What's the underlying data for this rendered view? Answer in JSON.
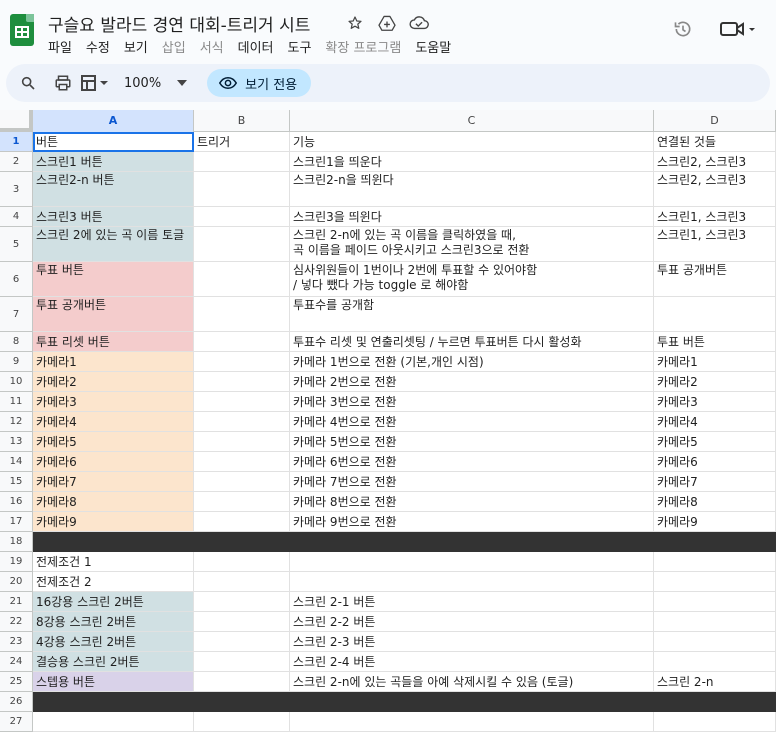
{
  "app": {
    "title": "구슬요 발라드 경연 대회-트리거 시트",
    "menus": [
      {
        "label": "파일",
        "dim": false
      },
      {
        "label": "수정",
        "dim": false
      },
      {
        "label": "보기",
        "dim": false
      },
      {
        "label": "삽입",
        "dim": true
      },
      {
        "label": "서식",
        "dim": true
      },
      {
        "label": "데이터",
        "dim": false
      },
      {
        "label": "도구",
        "dim": false
      },
      {
        "label": "확장 프로그램",
        "dim": true
      },
      {
        "label": "도움말",
        "dim": false
      }
    ],
    "icons": [
      "star-icon",
      "drive-add-icon",
      "cloud-status-icon",
      "history-icon",
      "video-call-icon"
    ]
  },
  "toolbar": {
    "zoom": "100%",
    "view_only_label": "보기 전용"
  },
  "colors": {
    "teal": "#d0e0e3",
    "pink": "#f4cccc",
    "orange": "#fce5cd",
    "purple": "#d9d2e9",
    "dark": "#333333"
  },
  "columns": [
    "A",
    "B",
    "C",
    "D"
  ],
  "rows": [
    {
      "n": "1",
      "h": 20,
      "fill": "",
      "cells": [
        "버튼",
        "트리거",
        "기능",
        "연결된 것들"
      ]
    },
    {
      "n": "2",
      "h": 20,
      "fill": "teal",
      "cells": [
        "스크린1 버튼",
        "",
        "스크린1을 띄운다",
        "스크린2, 스크린3"
      ]
    },
    {
      "n": "3",
      "h": 35,
      "fill": "teal",
      "cells": [
        "스크린2-n 버튼",
        "",
        "스크린2-n을 띄윈다",
        "스크린2, 스크린3"
      ]
    },
    {
      "n": "4",
      "h": 20,
      "fill": "teal",
      "cells": [
        "스크린3 버튼",
        "",
        "스크린3을 띄윈다",
        "스크린1, 스크린3"
      ]
    },
    {
      "n": "5",
      "h": 35,
      "fill": "teal",
      "cells": [
        "스크린 2에 있는 곡 이름 토글",
        "",
        "스크린 2-n에 있는 곡 이름을 클릭하였을 때,\n곡 이름을 페이드 아웃시키고 스크린3으로 전환",
        "스크린1, 스크린3"
      ]
    },
    {
      "n": "6",
      "h": 35,
      "fill": "pink",
      "cells": [
        "투표 버튼",
        "",
        "심사위원들이 1번이나 2번에 투표할 수 있어야함\n/ 넣다 뺐다 가능 toggle 로 해야함",
        "투표 공개버튼"
      ]
    },
    {
      "n": "7",
      "h": 35,
      "fill": "pink",
      "cells": [
        "투표 공개버튼",
        "",
        "투표수를 공개함",
        ""
      ]
    },
    {
      "n": "8",
      "h": 20,
      "fill": "pink",
      "cells": [
        "투표 리셋 버튼",
        "",
        "투표수 리셋 및 연출리셋팅 / 누르면 투표버튼 다시 활성화",
        "투표 버튼"
      ]
    },
    {
      "n": "9",
      "h": 20,
      "fill": "orange",
      "cells": [
        "카메라1",
        "",
        "카메라 1번으로 전환 (기본,개인 시점)",
        "카메라1"
      ]
    },
    {
      "n": "10",
      "h": 20,
      "fill": "orange",
      "cells": [
        "카메라2",
        "",
        "카메라 2번으로 전환",
        "카메라2"
      ]
    },
    {
      "n": "11",
      "h": 20,
      "fill": "orange",
      "cells": [
        "카메라3",
        "",
        "카메라 3번으로 전환",
        "카메라3"
      ]
    },
    {
      "n": "12",
      "h": 20,
      "fill": "orange",
      "cells": [
        "카메라4",
        "",
        "카메라 4번으로 전환",
        "카메라4"
      ]
    },
    {
      "n": "13",
      "h": 20,
      "fill": "orange",
      "cells": [
        "카메라5",
        "",
        "카메라 5번으로 전환",
        "카메라5"
      ]
    },
    {
      "n": "14",
      "h": 20,
      "fill": "orange",
      "cells": [
        "카메라6",
        "",
        "카메라 6번으로 전환",
        "카메라6"
      ]
    },
    {
      "n": "15",
      "h": 20,
      "fill": "orange",
      "cells": [
        "카메라7",
        "",
        "카메라 7번으로 전환",
        "카메라7"
      ]
    },
    {
      "n": "16",
      "h": 20,
      "fill": "orange",
      "cells": [
        "카메라8",
        "",
        "카메라 8번으로 전환",
        "카메라8"
      ]
    },
    {
      "n": "17",
      "h": 20,
      "fill": "orange",
      "cells": [
        "카메라9",
        "",
        "카메라 9번으로 전환",
        "카메라9"
      ]
    },
    {
      "n": "18",
      "h": 20,
      "fill": "dark",
      "cells": [
        "",
        "",
        "",
        ""
      ]
    },
    {
      "n": "19",
      "h": 20,
      "fill": "",
      "cells": [
        "전제조건 1",
        "",
        "",
        ""
      ]
    },
    {
      "n": "20",
      "h": 20,
      "fill": "",
      "cells": [
        "전제조건 2",
        "",
        "",
        ""
      ]
    },
    {
      "n": "21",
      "h": 20,
      "fill": "teal",
      "cells": [
        "16강용 스크린 2버튼",
        "",
        "스크린 2-1 버튼",
        ""
      ]
    },
    {
      "n": "22",
      "h": 20,
      "fill": "teal",
      "cells": [
        "8강용 스크린 2버튼",
        "",
        "스크린 2-2 버튼",
        ""
      ]
    },
    {
      "n": "23",
      "h": 20,
      "fill": "teal",
      "cells": [
        "4강용 스크린 2버튼",
        "",
        "스크린 2-3 버튼",
        ""
      ]
    },
    {
      "n": "24",
      "h": 20,
      "fill": "teal",
      "cells": [
        "결승용 스크린 2버튼",
        "",
        "스크린 2-4 버튼",
        ""
      ]
    },
    {
      "n": "25",
      "h": 20,
      "fill": "purple",
      "cells": [
        "스텝용 버튼",
        "",
        "스크린 2-n에 있는 곡들을 아예 삭제시킬 수 있음 (토글)",
        "스크린 2-n"
      ]
    },
    {
      "n": "26",
      "h": 20,
      "fill": "dark",
      "cells": [
        "",
        "",
        "",
        ""
      ]
    },
    {
      "n": "27",
      "h": 20,
      "fill": "",
      "cells": [
        "",
        "",
        "",
        ""
      ]
    }
  ]
}
